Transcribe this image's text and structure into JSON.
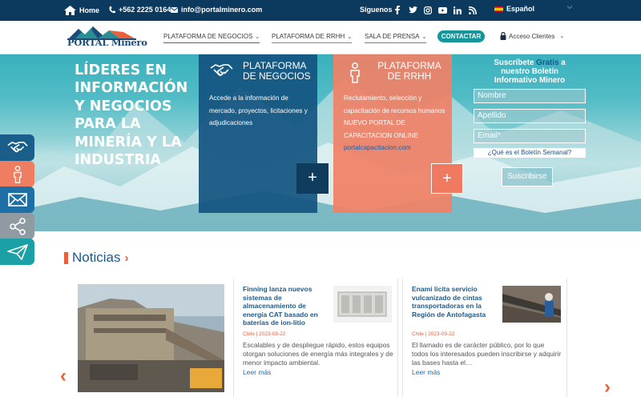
{
  "topbar": {
    "home": "Home",
    "phone": "+562 2225 0164",
    "email": "info@portalminero.com",
    "follow": "Síguenos",
    "language": "Español",
    "social_icons": [
      "facebook-icon",
      "twitter-icon",
      "instagram-icon",
      "youtube-icon",
      "linkedin-icon",
      "rss-icon"
    ]
  },
  "header": {
    "logo": "PORTAL Minero",
    "nav": [
      {
        "label": "PLATAFORMA DE NEGOCIOS"
      },
      {
        "label": "PLATAFORMA DE RRHH"
      },
      {
        "label": "SALA DE PRENSA"
      }
    ],
    "contact": "CONTACTAR",
    "access": "Acceso Clientes"
  },
  "hero": {
    "title": "LÍDERES EN INFORMACIÓN Y NEGOCIOS PARA LA MINERÍA Y LA INDUSTRIA",
    "negocios": {
      "title_line1": "PLATAFORMA",
      "title_line2": "DE NEGOCIOS",
      "body": "Accede a la información de mercado, proyectos, licitaciones y adjudicaciones",
      "plus": "+"
    },
    "rrhh": {
      "title_line1": "PLATAFORMA",
      "title_line2": "DE RRHH",
      "body": "Reclutamiento, selección y capacitación de recursos humanos",
      "portal": "NUEVO PORTAL DE CAPACITACION ONLINE",
      "link": "portalcapacitacion.com",
      "plus": "+"
    },
    "newsletter": {
      "title_pre": "Suscríbete",
      "title_gratis": "Gratis",
      "title_post": "a nuestro Boletín Informativo Minero",
      "name_placeholder": "Nombre",
      "surname_placeholder": "Apellido",
      "email_placeholder": "Email*",
      "question": "¿Qué es el Boletín Semanal?",
      "submit": "Suscribirse"
    }
  },
  "news": {
    "heading": "Noticias",
    "items": [
      {
        "title": "Finning lanza nuevos sistemas de almacenamiento de energía CAT basado en baterías de ion-litio",
        "meta": "Chile | 2023-09-22",
        "excerpt": "Escalables y de despliegue rápido, estos equipos otorgan soluciones de energía más integrales y de menor impacto ambiental.",
        "more": "Leer más"
      },
      {
        "title": "Enami licita servicio vulcanizado de cintas transportadoras en la Región de Antofagasta",
        "meta": "Chile | 2023-09-22",
        "excerpt": "El llamado es de carácter público, por lo que todos los interesados pueden inscribirse y adquirir las bases hasta el…",
        "more": "Leer más"
      }
    ]
  },
  "colors": {
    "navy": "#0c3a5e",
    "teal": "#15969b",
    "orange": "#e8603c",
    "blue_card": "#125480",
    "salmon_card": "#f08166"
  }
}
